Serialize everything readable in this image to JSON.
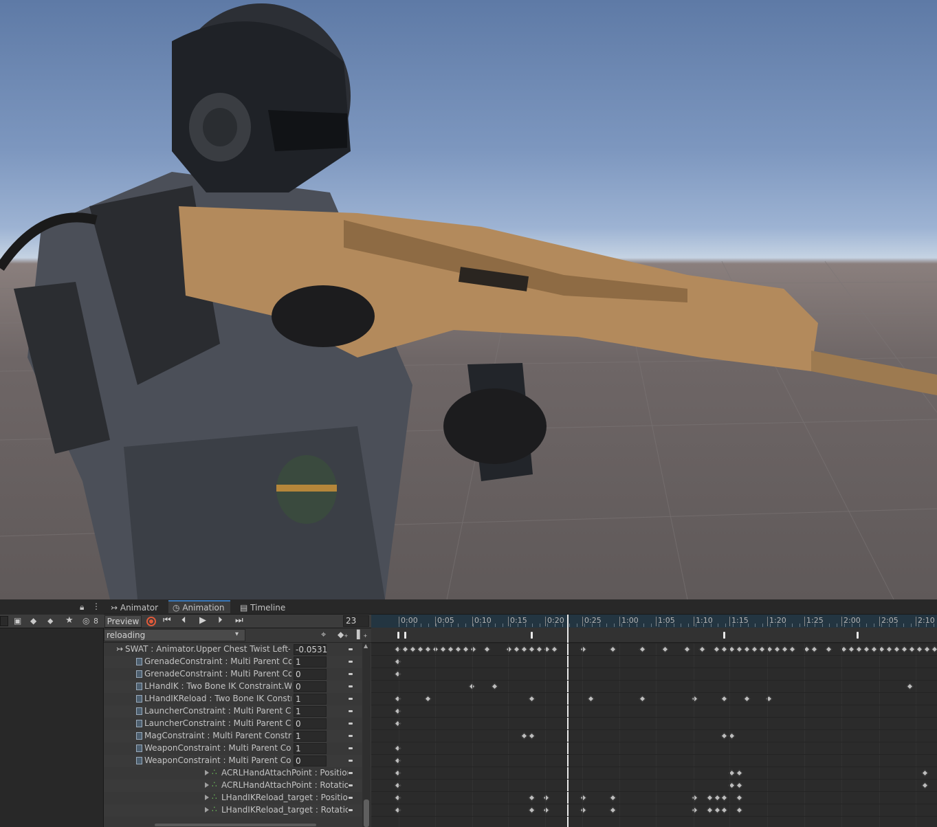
{
  "viewport": {
    "description_icon": "scene-3d-viewport"
  },
  "tabs": [
    {
      "label": "Animator",
      "icon": "animator-icon"
    },
    {
      "label": "Animation",
      "icon": "clock-icon",
      "active": true
    },
    {
      "label": "Timeline",
      "icon": "film-icon"
    }
  ],
  "left_toolbar": {
    "layer_count": "8"
  },
  "toolbar": {
    "preview_label": "Preview",
    "frame_value": "23",
    "clip_name": "reloading"
  },
  "ruler": {
    "labels": [
      "0:00",
      "0:05",
      "0:10",
      "0:15",
      "0:20",
      "0:25",
      "1:00",
      "1:05",
      "1:10",
      "1:15",
      "1:20",
      "1:25",
      "2:00",
      "2:05",
      "2:10"
    ]
  },
  "properties": [
    {
      "label": "SWAT : Animator.Upper Chest Twist Left-R",
      "value": "-0.0531",
      "type": "root"
    },
    {
      "label": "GrenadeConstraint : Multi Parent Cons",
      "value": "1",
      "type": "doc"
    },
    {
      "label": "GrenadeConstraint : Multi Parent Cons",
      "value": "0",
      "type": "doc"
    },
    {
      "label": "LHandIK : Two Bone IK Constraint.Wei",
      "value": "0",
      "type": "doc"
    },
    {
      "label": "LHandIKReload : Two Bone IK Constra",
      "value": "1",
      "type": "doc"
    },
    {
      "label": "LauncherConstraint : Multi Parent Con",
      "value": "1",
      "type": "doc"
    },
    {
      "label": "LauncherConstraint : Multi Parent Con",
      "value": "0",
      "type": "doc"
    },
    {
      "label": "MagConstraint : Multi Parent Constrair",
      "value": "1",
      "type": "doc"
    },
    {
      "label": "WeaponConstraint : Multi Parent Cons",
      "value": "1",
      "type": "doc"
    },
    {
      "label": "WeaponConstraint : Multi Parent Cons",
      "value": "0",
      "type": "doc"
    },
    {
      "label": "ACRLHandAttachPoint : Position",
      "value": "",
      "type": "transform"
    },
    {
      "label": "ACRLHandAttachPoint : Rotation",
      "value": "",
      "type": "transform"
    },
    {
      "label": "LHandIKReload_target : Position",
      "value": "",
      "type": "transform"
    },
    {
      "label": "LHandIKReload_target : Rotation",
      "value": "",
      "type": "transform"
    }
  ]
}
